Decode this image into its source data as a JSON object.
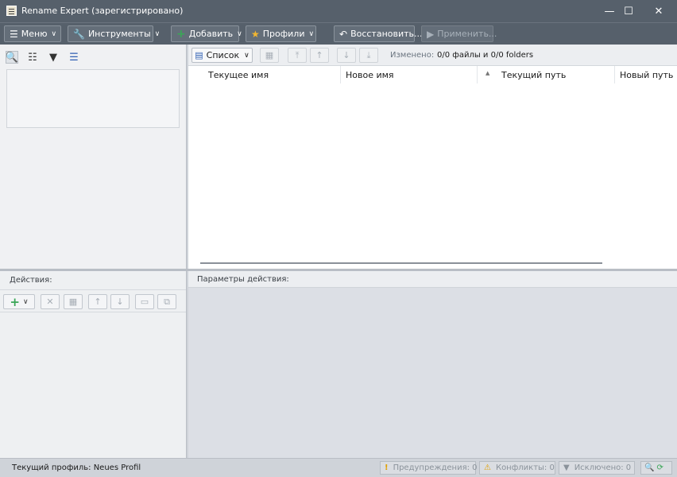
{
  "window": {
    "title": "Rename Expert (зарегистрировано)",
    "minimize": "—",
    "maximize": "☐",
    "close": "✕"
  },
  "toolbar": {
    "menu_label": "Меню",
    "tools_label": "Инструменты",
    "add_label": "Добавить",
    "profiles_label": "Профили",
    "restore_label": "Восстановить...",
    "apply_label": "Применить..."
  },
  "files_toolbar": {
    "view_label": "Список",
    "changed_label": "Изменено:",
    "changed_value": "0/0 файлы и 0/0 folders"
  },
  "columns": [
    "Текущее имя",
    "Новое имя",
    "Текущий путь",
    "Новый путь"
  ],
  "actions": {
    "label": "Действия:"
  },
  "params": {
    "label": "Параметры действия:"
  },
  "status": {
    "profile_text": "Текущий профиль: Neues Profil",
    "warnings": "Предупреждения: 0",
    "conflicts": "Конфликты: 0",
    "excluded": "Исключено: 0"
  },
  "colors": {
    "titlebar": "#56606b",
    "accent_green": "#3aa657",
    "accent_star": "#f2b630"
  }
}
